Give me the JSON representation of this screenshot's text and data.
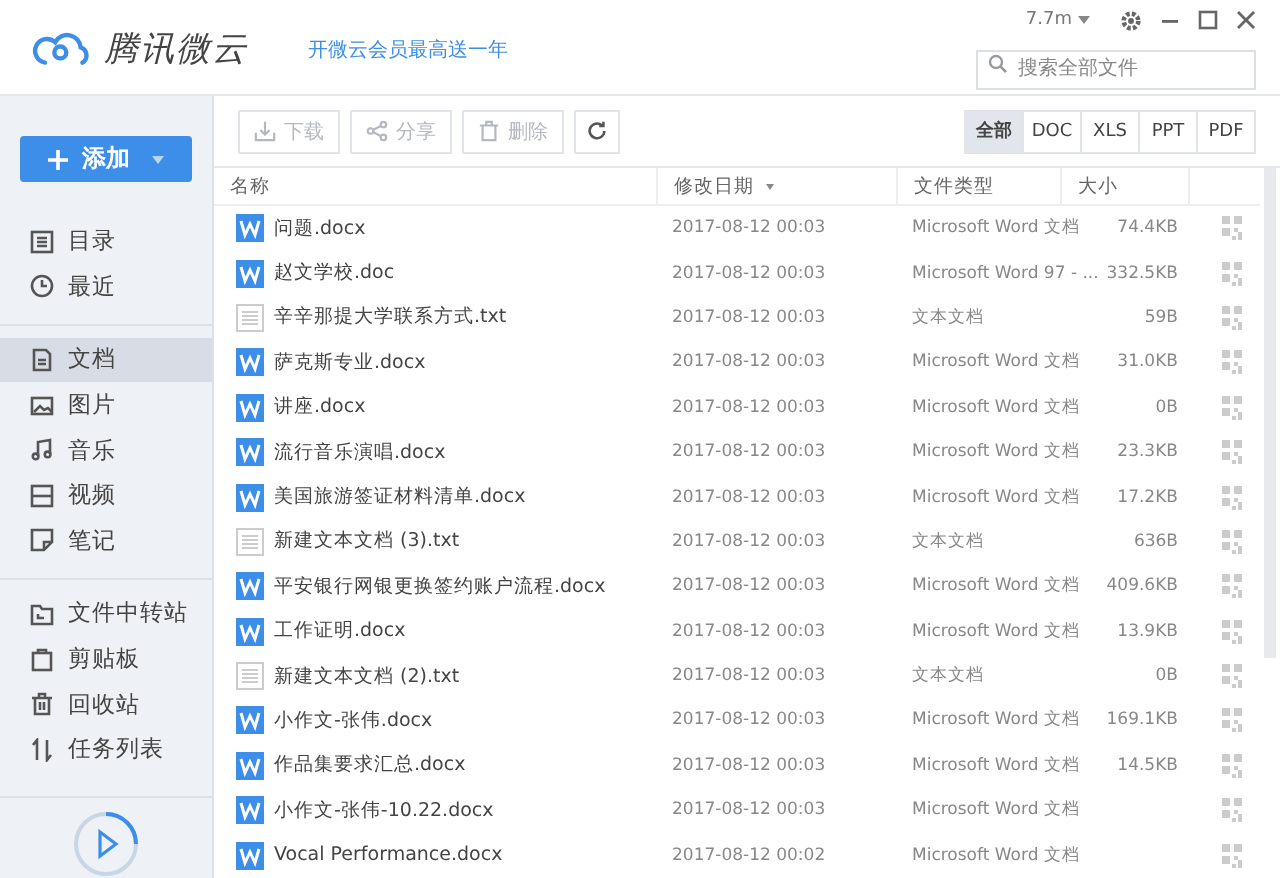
{
  "app": {
    "logo": "腾讯微云",
    "promo": "开微云会员最高送一年",
    "speed": "7.7m",
    "search": {
      "placeholder": "搜索全部文件"
    }
  },
  "add_button": "添加",
  "sidebar": {
    "groups": [
      [
        {
          "label": "目录",
          "kind": "list",
          "selected": false
        },
        {
          "label": "最近",
          "kind": "clock",
          "selected": false
        }
      ],
      [
        {
          "label": "文档",
          "kind": "doc",
          "selected": true
        },
        {
          "label": "图片",
          "kind": "image",
          "selected": false
        },
        {
          "label": "音乐",
          "kind": "music",
          "selected": false
        },
        {
          "label": "视频",
          "kind": "video",
          "selected": false
        },
        {
          "label": "笔记",
          "kind": "note",
          "selected": false
        }
      ],
      [
        {
          "label": "文件中转站",
          "kind": "folder",
          "selected": false
        },
        {
          "label": "剪贴板",
          "kind": "clipboard",
          "selected": false
        },
        {
          "label": "回收站",
          "kind": "trash",
          "selected": false
        },
        {
          "label": "任务列表",
          "kind": "transfer",
          "selected": false
        }
      ]
    ]
  },
  "toolbar": {
    "actions": [
      {
        "label": "下载",
        "kind": "download",
        "disabled": true
      },
      {
        "label": "分享",
        "kind": "share",
        "disabled": true
      },
      {
        "label": "删除",
        "kind": "trash",
        "disabled": true
      }
    ]
  },
  "filters": [
    {
      "label": "全部",
      "selected": true
    },
    {
      "label": "DOC",
      "selected": false
    },
    {
      "label": "XLS",
      "selected": false
    },
    {
      "label": "PPT",
      "selected": false
    },
    {
      "label": "PDF",
      "selected": false
    }
  ],
  "table": {
    "columns": [
      {
        "label": "名称",
        "sorted": false
      },
      {
        "label": "修改日期",
        "sorted": true
      },
      {
        "label": "文件类型",
        "sorted": false
      },
      {
        "label": "大小",
        "sorted": false
      }
    ],
    "rows": [
      {
        "kind": "word",
        "name": "问题.docx",
        "date": "2017-08-12 00:03",
        "type": "Microsoft Word 文档",
        "size": "74.4KB"
      },
      {
        "kind": "word",
        "name": "赵文学校.doc",
        "date": "2017-08-12 00:03",
        "type": "Microsoft Word 97 - ...",
        "size": "332.5KB"
      },
      {
        "kind": "text",
        "name": "辛辛那提大学联系方式.txt",
        "date": "2017-08-12 00:03",
        "type": "文本文档",
        "size": "59B"
      },
      {
        "kind": "word",
        "name": "萨克斯专业.docx",
        "date": "2017-08-12 00:03",
        "type": "Microsoft Word 文档",
        "size": "31.0KB"
      },
      {
        "kind": "word",
        "name": "讲座.docx",
        "date": "2017-08-12 00:03",
        "type": "Microsoft Word 文档",
        "size": "0B"
      },
      {
        "kind": "word",
        "name": "流行音乐演唱.docx",
        "date": "2017-08-12 00:03",
        "type": "Microsoft Word 文档",
        "size": "23.3KB"
      },
      {
        "kind": "word",
        "name": "美国旅游签证材料清单.docx",
        "date": "2017-08-12 00:03",
        "type": "Microsoft Word 文档",
        "size": "17.2KB"
      },
      {
        "kind": "text",
        "name": "新建文本文档 (3).txt",
        "date": "2017-08-12 00:03",
        "type": "文本文档",
        "size": "636B"
      },
      {
        "kind": "word",
        "name": "平安银行网银更换签约账户流程.docx",
        "date": "2017-08-12 00:03",
        "type": "Microsoft Word 文档",
        "size": "409.6KB"
      },
      {
        "kind": "word",
        "name": "工作证明.docx",
        "date": "2017-08-12 00:03",
        "type": "Microsoft Word 文档",
        "size": "13.9KB"
      },
      {
        "kind": "text",
        "name": "新建文本文档 (2).txt",
        "date": "2017-08-12 00:03",
        "type": "文本文档",
        "size": "0B"
      },
      {
        "kind": "word",
        "name": "小作文-张伟.docx",
        "date": "2017-08-12 00:03",
        "type": "Microsoft Word 文档",
        "size": "169.1KB"
      },
      {
        "kind": "word",
        "name": "作品集要求汇总.docx",
        "date": "2017-08-12 00:03",
        "type": "Microsoft Word 文档",
        "size": "14.5KB"
      },
      {
        "kind": "word",
        "name": "小作文-张伟-10.22.docx",
        "date": "2017-08-12 00:03",
        "type": "Microsoft Word 文档"
      },
      {
        "kind": "word",
        "name": "Vocal Performance.docx",
        "date": "2017-08-12 00:02",
        "type": "Microsoft Word 文档"
      }
    ]
  }
}
